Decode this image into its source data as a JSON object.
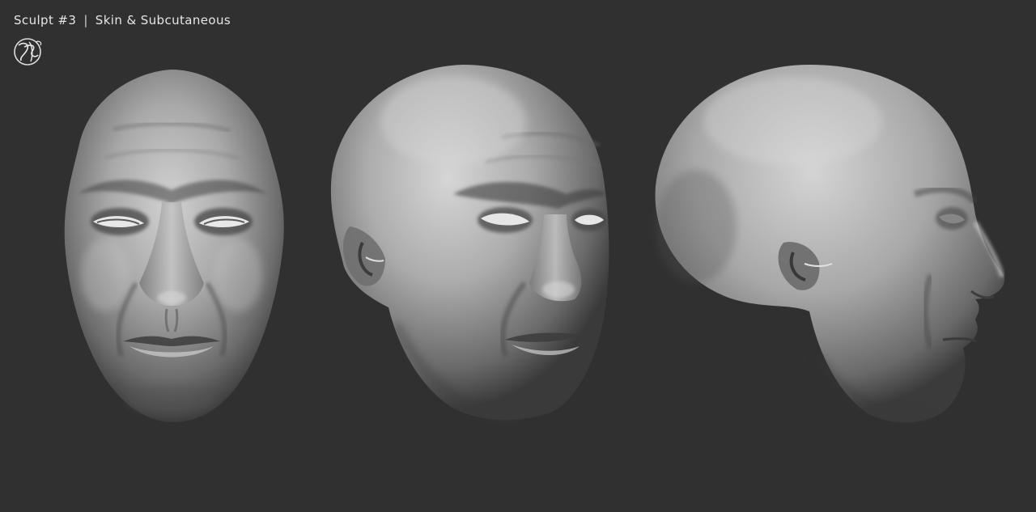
{
  "caption": {
    "title": "Sculpt #3",
    "separator": "|",
    "subtitle": "Skin & Subcutaneous"
  },
  "logo": {
    "icon": "artist-monogram-logo"
  },
  "views": [
    {
      "name": "front-view",
      "icon": "head-front-sculpt"
    },
    {
      "name": "three-quarter-view",
      "icon": "head-three-quarter-sculpt"
    },
    {
      "name": "profile-view",
      "icon": "head-profile-sculpt"
    }
  ],
  "colors": {
    "background": "#303030",
    "clay_light": "#c9c9c9",
    "clay_mid": "#8f8f8f",
    "clay_dark": "#4a4a4a",
    "caption_text": "#e6e6e6"
  }
}
